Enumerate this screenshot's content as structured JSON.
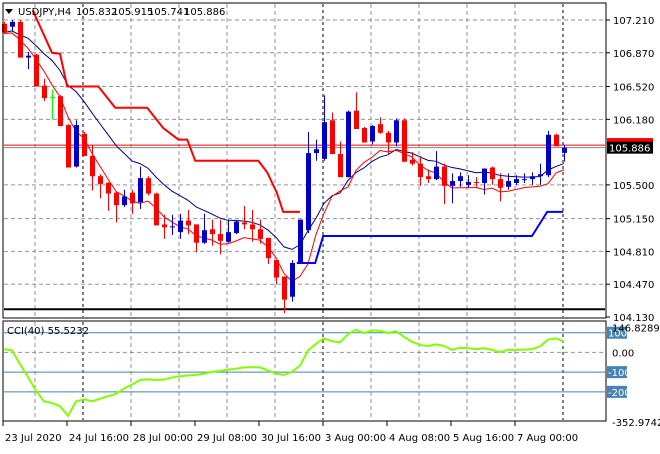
{
  "header": {
    "symbol_timeframe": "USDJPY,H4",
    "open": "105.832",
    "high": "105.915",
    "low": "105.741",
    "close": "105.886"
  },
  "colors": {
    "bull": "#0000c8",
    "bear": "#ff0000",
    "doji": "#00ff00",
    "ma_fast": "#ff0000",
    "ma_slow": "#000080",
    "upper_band": "#ff0000",
    "lower_band": "#0000ff",
    "cci_line": "#80ff00",
    "cci_levels": "#4682b4"
  },
  "price_axis": {
    "labels": [
      "107.210",
      "106.870",
      "106.520",
      "106.180",
      "105.500",
      "105.150",
      "104.810",
      "104.470",
      "104.130"
    ],
    "current_price_label": "105.886",
    "range": [
      104.13,
      107.21
    ]
  },
  "time_axis": {
    "labels": [
      "23 Jul 2020",
      "24 Jul 16:00",
      "28 Jul 00:00",
      "29 Jul 08:00",
      "30 Jul 16:00",
      "3 Aug 00:00",
      "4 Aug 08:00",
      "5 Aug 16:00",
      "7 Aug 00:00"
    ],
    "candles_per_label": 8
  },
  "chart_data": {
    "type": "candlestick",
    "symbol": "USDJPY",
    "timeframe": "H4",
    "ohlc": [
      [
        107.17,
        107.19,
        107.07,
        107.08
      ],
      [
        107.14,
        107.21,
        107.09,
        107.19
      ],
      [
        107.19,
        107.21,
        106.82,
        106.82
      ],
      [
        106.82,
        106.88,
        106.7,
        106.84
      ],
      [
        106.85,
        106.86,
        106.52,
        106.52
      ],
      [
        106.53,
        106.6,
        106.37,
        106.4
      ],
      [
        106.41,
        106.49,
        106.18,
        106.41
      ],
      [
        106.42,
        106.43,
        106.11,
        106.11
      ],
      [
        106.12,
        106.13,
        105.68,
        105.68
      ],
      [
        105.69,
        106.17,
        105.68,
        106.12
      ],
      [
        106.03,
        106.05,
        105.8,
        105.8
      ],
      [
        105.8,
        105.91,
        105.44,
        105.59
      ],
      [
        105.59,
        105.61,
        105.36,
        105.51
      ],
      [
        105.52,
        105.53,
        105.23,
        105.41
      ],
      [
        105.42,
        105.43,
        105.11,
        105.29
      ],
      [
        105.29,
        105.45,
        105.27,
        105.38
      ],
      [
        105.42,
        105.45,
        105.2,
        105.31
      ],
      [
        105.32,
        105.69,
        105.25,
        105.57
      ],
      [
        105.57,
        105.59,
        105.39,
        105.41
      ],
      [
        105.41,
        105.42,
        105.08,
        105.08
      ],
      [
        105.09,
        105.19,
        104.94,
        105.06
      ],
      [
        105.06,
        105.19,
        104.98,
        105.07
      ],
      [
        105.01,
        105.2,
        104.94,
        105.13
      ],
      [
        105.13,
        105.24,
        104.99,
        105.08
      ],
      [
        105.09,
        105.09,
        104.8,
        104.9
      ],
      [
        104.9,
        105.2,
        104.89,
        105.03
      ],
      [
        105.04,
        105.14,
        104.87,
        104.99
      ],
      [
        104.99,
        105.14,
        104.78,
        104.92
      ],
      [
        104.91,
        105.14,
        104.9,
        105.01
      ],
      [
        105.0,
        105.13,
        104.99,
        105.12
      ],
      [
        105.11,
        105.28,
        105.04,
        105.09
      ],
      [
        105.09,
        105.24,
        104.91,
        105.04
      ],
      [
        105.04,
        105.14,
        104.89,
        104.94
      ],
      [
        104.95,
        104.95,
        104.68,
        104.74
      ],
      [
        104.72,
        104.72,
        104.47,
        104.54
      ],
      [
        104.55,
        104.55,
        104.17,
        104.31
      ],
      [
        104.34,
        104.72,
        104.29,
        104.69
      ],
      [
        104.69,
        105.14,
        104.69,
        105.14
      ],
      [
        105.03,
        106.05,
        105.0,
        105.83
      ],
      [
        105.83,
        105.97,
        105.75,
        105.87
      ],
      [
        105.77,
        106.43,
        105.75,
        106.15
      ],
      [
        106.17,
        106.25,
        105.82,
        105.82
      ],
      [
        105.82,
        105.95,
        105.58,
        105.58
      ],
      [
        105.58,
        106.27,
        105.58,
        106.26
      ],
      [
        106.27,
        106.46,
        106.08,
        106.08
      ],
      [
        106.09,
        106.1,
        105.94,
        105.94
      ],
      [
        105.95,
        106.12,
        105.92,
        106.11
      ],
      [
        106.13,
        106.2,
        106.03,
        106.04
      ],
      [
        106.04,
        106.06,
        105.81,
        105.94
      ],
      [
        105.94,
        106.19,
        105.9,
        106.17
      ],
      [
        106.17,
        106.19,
        105.74,
        105.74
      ],
      [
        105.76,
        105.84,
        105.7,
        105.72
      ],
      [
        105.72,
        105.8,
        105.49,
        105.58
      ],
      [
        105.59,
        105.66,
        105.52,
        105.56
      ],
      [
        105.56,
        105.85,
        105.55,
        105.69
      ],
      [
        105.69,
        105.72,
        105.3,
        105.49
      ],
      [
        105.49,
        105.62,
        105.31,
        105.54
      ],
      [
        105.54,
        105.63,
        105.48,
        105.59
      ],
      [
        105.5,
        105.6,
        105.47,
        105.53
      ],
      [
        105.53,
        105.58,
        105.48,
        105.52
      ],
      [
        105.52,
        105.67,
        105.4,
        105.67
      ],
      [
        105.68,
        105.69,
        105.5,
        105.56
      ],
      [
        105.56,
        105.62,
        105.33,
        105.47
      ],
      [
        105.48,
        105.62,
        105.45,
        105.54
      ],
      [
        105.52,
        105.6,
        105.5,
        105.56
      ],
      [
        105.56,
        105.62,
        105.52,
        105.56
      ],
      [
        105.56,
        105.63,
        105.5,
        105.59
      ],
      [
        105.59,
        105.72,
        105.5,
        105.61
      ],
      [
        105.6,
        106.06,
        105.58,
        106.02
      ],
      [
        106.02,
        106.03,
        105.9,
        105.9
      ],
      [
        105.832,
        105.915,
        105.741,
        105.886
      ]
    ],
    "upper_band": [
      [
        3.6,
        107.31
      ],
      [
        6,
        106.87
      ],
      [
        7,
        106.86
      ],
      [
        7.9,
        106.52
      ],
      [
        11.8,
        106.52
      ],
      [
        13.9,
        106.3
      ],
      [
        17.9,
        106.3
      ],
      [
        19.9,
        106.09
      ],
      [
        21.8,
        105.97
      ],
      [
        22.9,
        105.97
      ],
      [
        23.9,
        105.75
      ],
      [
        31.8,
        105.75
      ],
      [
        32.9,
        105.63
      ],
      [
        34.1,
        105.42
      ],
      [
        34.9,
        105.22
      ],
      [
        37,
        105.22
      ]
    ],
    "lower_band": [
      [
        36.6,
        104.69
      ],
      [
        38.9,
        104.69
      ],
      [
        39.9,
        104.97
      ],
      [
        66,
        104.97
      ],
      [
        67.9,
        105.22
      ],
      [
        69.9,
        105.22
      ]
    ],
    "horizontal_line": 104.21,
    "ask_line": 105.913,
    "ylim": [
      104.13,
      107.21
    ]
  },
  "cci": {
    "label": "CCI(40) 55.5232",
    "range_labels": {
      "max": "146.8289",
      "zero": "0.00",
      "min": "-352.9742"
    },
    "range": [
      -352.9742,
      146.8289
    ],
    "levels": [
      {
        "value": 100,
        "label": "100"
      },
      {
        "value": -100,
        "label": "-100"
      },
      {
        "value": -200,
        "label": "-200"
      }
    ],
    "values": [
      15.9,
      11,
      -60,
      -125,
      -194,
      -248,
      -257,
      -273,
      -322,
      -249,
      -238,
      -248,
      -235,
      -222,
      -210,
      -183,
      -163,
      -140,
      -137,
      -140,
      -138,
      -127,
      -121,
      -117,
      -114,
      -108,
      -98,
      -94,
      -87,
      -83,
      -76,
      -75,
      -76,
      -92,
      -108,
      -114,
      -98,
      -67,
      10,
      44,
      71,
      57,
      51,
      92,
      116,
      98,
      111,
      110,
      98,
      108,
      79,
      54,
      38,
      33,
      41,
      33,
      13,
      24,
      21,
      17,
      22,
      13,
      2,
      13,
      13,
      14,
      17,
      30,
      65,
      71,
      55.5
    ]
  }
}
